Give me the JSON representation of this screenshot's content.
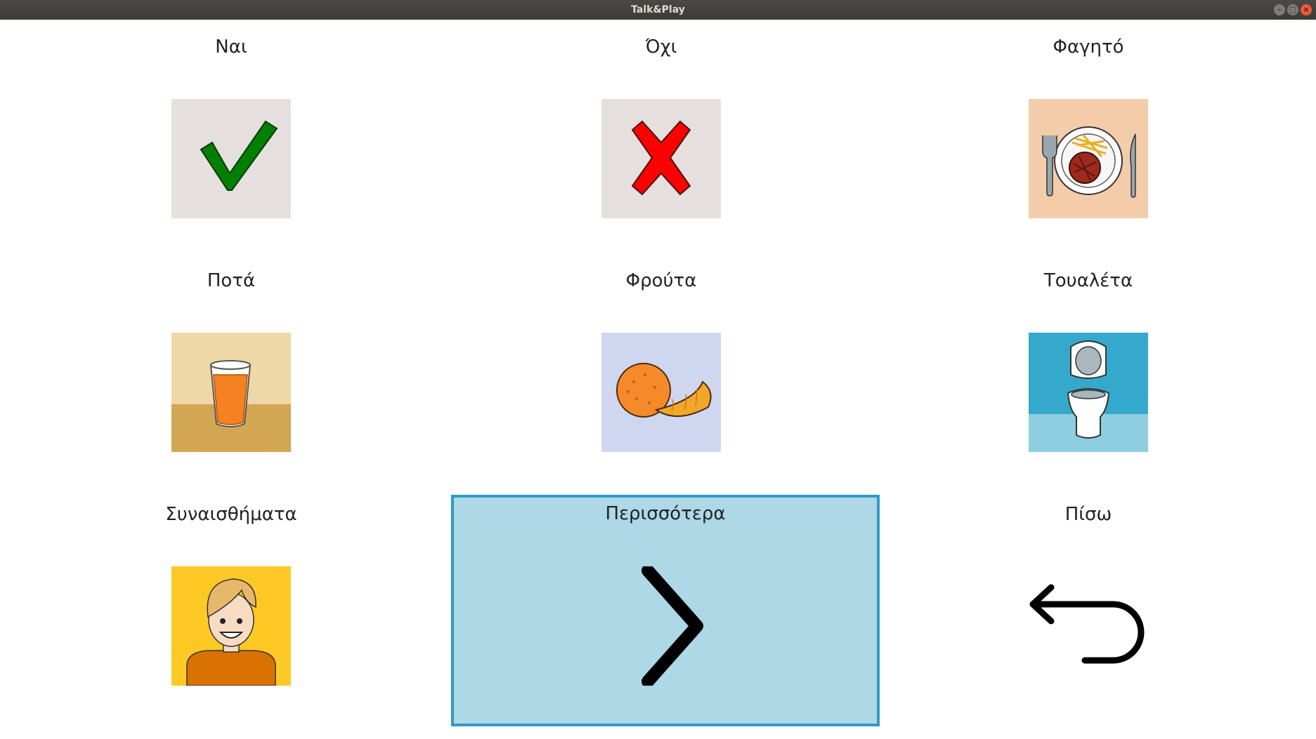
{
  "window": {
    "title": "Talk&Play",
    "controls": [
      "–",
      "□",
      "×"
    ]
  },
  "grid": {
    "cells": [
      {
        "label": "Ναι",
        "icon": "checkmark-icon"
      },
      {
        "label": "Όχι",
        "icon": "cross-icon"
      },
      {
        "label": "Φαγητό",
        "icon": "food-plate-icon"
      },
      {
        "label": "Ποτά",
        "icon": "juice-glass-icon"
      },
      {
        "label": "Φρούτα",
        "icon": "orange-fruit-icon"
      },
      {
        "label": "Τουαλέτα",
        "icon": "toilet-icon"
      },
      {
        "label": "Συναισθήματα",
        "icon": "smiling-person-icon"
      },
      {
        "label": "Περισσότερα",
        "icon": "chevron-right-icon",
        "selected": true
      },
      {
        "label": "Πίσω",
        "icon": "back-arrow-icon"
      }
    ]
  },
  "colors": {
    "selected_background": "#add8e6",
    "selected_border": "#2f9ac6",
    "yes_green": "#008000",
    "no_red": "#ff0000"
  }
}
